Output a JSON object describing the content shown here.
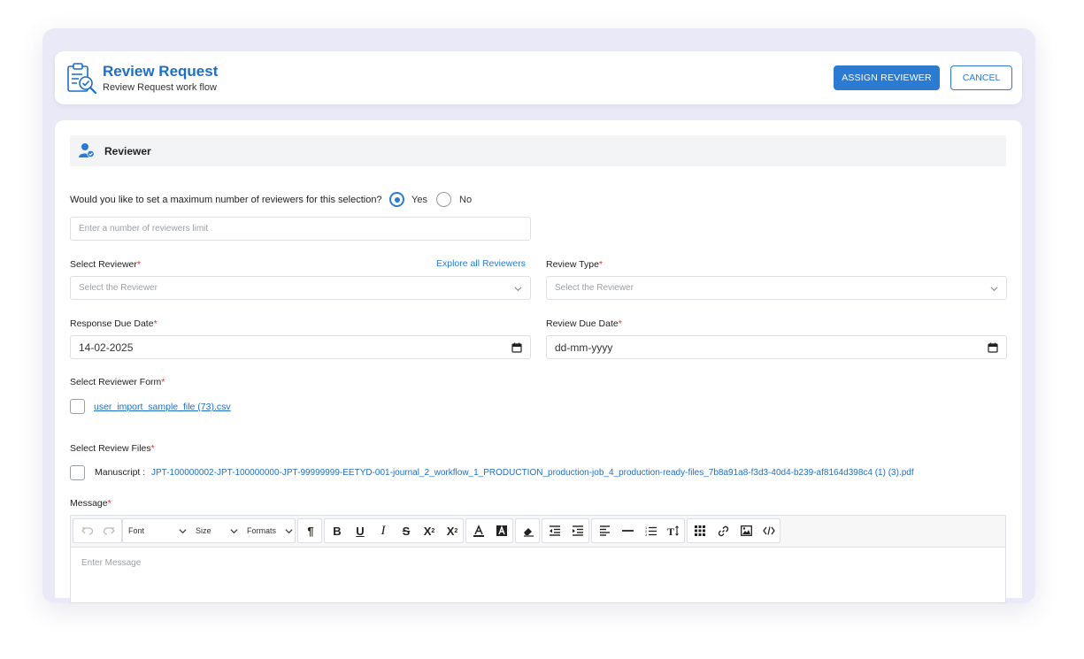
{
  "header": {
    "title": "Review Request",
    "subtitle": "Review Request work flow",
    "assign_label": "ASSIGN REVIEWER",
    "cancel_label": "CANCEL"
  },
  "section": {
    "title": "Reviewer"
  },
  "max_reviewers": {
    "question": "Would you like to set a maximum number of reviewers for this selection?",
    "yes_label": "Yes",
    "no_label": "No",
    "selected": "Yes",
    "placeholder": "Enter a number of reviewers limit"
  },
  "select_reviewer": {
    "label": "Select Reviewer",
    "explore_link": "Explore all Reviewers",
    "placeholder": "Select the Reviewer"
  },
  "review_type": {
    "label": "Review Type",
    "placeholder": "Select the Reviewer"
  },
  "response_due": {
    "label": "Response Due Date",
    "value": "14-02-2025"
  },
  "review_due": {
    "label": "Review Due Date",
    "value": "dd-mm-yyyy"
  },
  "reviewer_form": {
    "label": "Select Reviewer Form",
    "file": "user_import_sample_file (73).csv"
  },
  "review_files": {
    "label": "Select Review Files",
    "manuscript_label": "Manuscript :",
    "manuscript_file": "JPT-100000002-JPT-100000000-JPT-99999999-EETYD-001-journal_2_workflow_1_PRODUCTION_production-job_4_production-ready-files_7b8a91a8-f3d3-40d4-b239-af8164d398c4 (1) (3).pdf"
  },
  "message": {
    "label": "Message",
    "placeholder": "Enter Message",
    "toolbar": {
      "font": "Font",
      "size": "Size",
      "formats": "Formats"
    }
  },
  "required_mark": "*",
  "colors": {
    "accent": "#2b7bd3",
    "title": "#1d6fc6",
    "required": "#e03030"
  }
}
